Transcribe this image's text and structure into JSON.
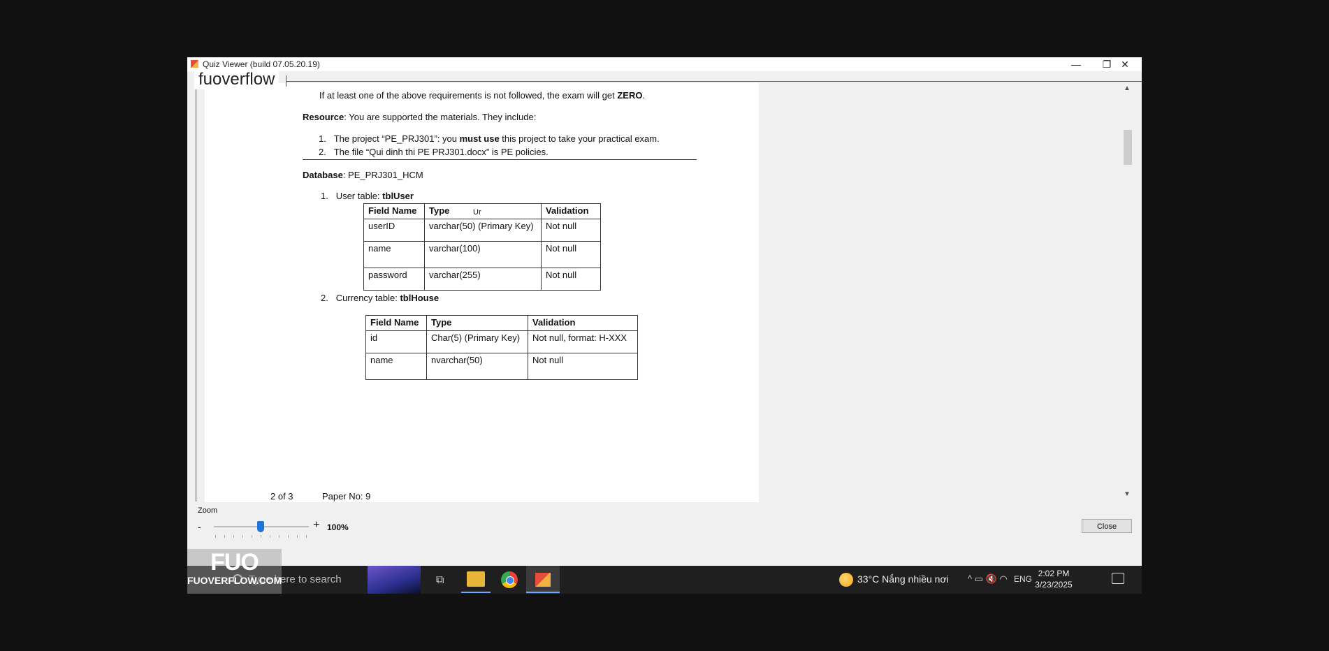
{
  "window": {
    "title": "Quiz Viewer (build 07.05.20.19)",
    "minimize_glyph": "—",
    "maximize_glyph": "❐",
    "close_glyph": "✕"
  },
  "watermark": {
    "top_text": "fuoverflow",
    "logo_big": "FUO",
    "logo_small": "FUOVERFLOW.COM"
  },
  "document": {
    "req_line_pre": "If at least one of the above requirements is not followed, the exam will get ",
    "req_line_bold": "ZERO",
    "req_line_post": ".",
    "resource_label": "Resource",
    "resource_text": ":   You are supported the materials. They include:",
    "resource_items": [
      {
        "num": "1.",
        "pre": "The project “PE_PRJ301”: you ",
        "bold": "must use",
        "post": " this project to take your practical exam."
      },
      {
        "num": "2.",
        "pre": "The file “Qui dinh thi PE PRJ301.docx” is PE policies.",
        "bold": "",
        "post": ""
      }
    ],
    "database_label": "Database",
    "database_text": ":   PE_PRJ301_HCM",
    "table1_caption_num": "1.",
    "table1_caption_pre": "User table: ",
    "table1_caption_bold": "tblUser",
    "table1": {
      "headers": [
        "Field Name",
        "Type",
        "Validation"
      ],
      "rows": [
        [
          "userID",
          "varchar(50) (Primary Key)",
          "Not null"
        ],
        [
          "name",
          "varchar(100)",
          "Not null"
        ],
        [
          "password",
          "varchar(255)",
          "Not null"
        ]
      ]
    },
    "stray_text": "Ur",
    "table2_caption_num": "2.",
    "table2_caption_pre": "Currency table: ",
    "table2_caption_bold": "tblHouse",
    "table2": {
      "headers": [
        "Field Name",
        "Type",
        "Validation"
      ],
      "rows": [
        [
          "id",
          "Char(5) (Primary Key)",
          "Not null, format: H-XXX"
        ],
        [
          "name",
          "nvarchar(50)",
          "Not null"
        ]
      ]
    },
    "footer_page": "2 of 3",
    "footer_paper": "Paper No: 9"
  },
  "zoom": {
    "label": "Zoom",
    "minus": "-",
    "plus": "+",
    "value": "100%",
    "level_fraction": 0.45
  },
  "close_button": "Close",
  "taskbar": {
    "search_placeholder": "Type here to search",
    "task_view_glyph": "⧉",
    "weather": "33°C  Nắng nhiều nơi",
    "tray_icons": "^  ▭  🔇  ◠",
    "language": "ENG",
    "time": "2:02 PM",
    "date": "3/23/2025",
    "icons": [
      "search-icon",
      "task-view-icon",
      "file-explorer-icon",
      "chrome-icon",
      "quiz-app-icon",
      "weather-icon",
      "notification-icon"
    ]
  }
}
